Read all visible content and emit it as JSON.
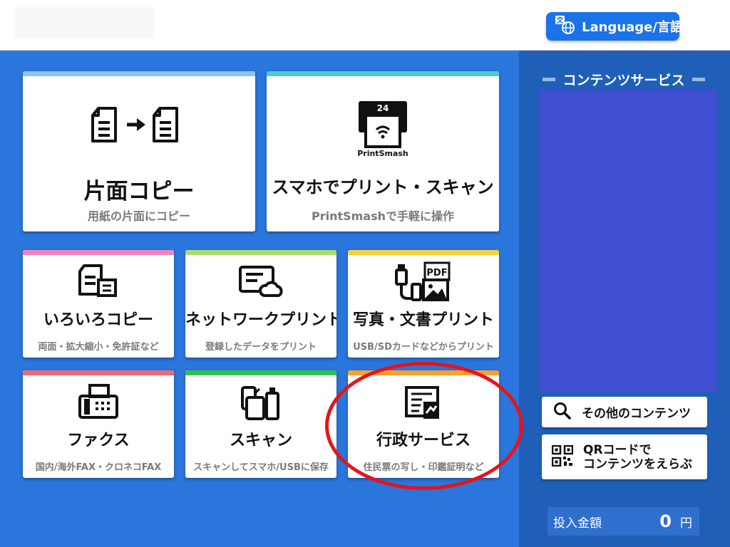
{
  "header": {
    "language_label": "Language/言語",
    "language_icon": "translate-globe-icon"
  },
  "tiles": {
    "single_copy": {
      "title": "片面コピー",
      "subtitle": "用紙の片面にコピー",
      "accent": "#8cc3f5",
      "icon": "document-copy-icon"
    },
    "smartphone_print": {
      "title": "スマホでプリント・スキャン",
      "subtitle": "PrintSmashで手軽に操作",
      "accent": "#4dcfc0",
      "icon": "printsmash-icon",
      "icon_top_label": "24",
      "icon_bottom_label": "PrintSmash"
    },
    "various_copy": {
      "title": "いろいろコピー",
      "subtitle": "両面・拡大縮小・免許証など",
      "accent": "#f084bb",
      "icon": "multi-copy-icon"
    },
    "network_print": {
      "title": "ネットワークプリント",
      "subtitle": "登録したデータをプリント",
      "accent": "#a6e06a",
      "icon": "cloud-document-icon"
    },
    "photo_doc_print": {
      "title": "写真・文書プリント",
      "subtitle": "USB/SDカードなどからプリント",
      "accent": "#f5d23a",
      "icon": "usb-pdf-photo-icon",
      "icon_label": "PDF"
    },
    "fax": {
      "title": "ファクス",
      "subtitle": "国内/海外FAX・クロネコFAX",
      "accent": "#ee6a77",
      "icon": "fax-icon"
    },
    "scan": {
      "title": "スキャン",
      "subtitle": "スキャンしてスマホ/USBに保存",
      "accent": "#32c14a",
      "icon": "scan-device-icon"
    },
    "government": {
      "title": "行政サービス",
      "subtitle": "住民票の写し・印鑑証明など",
      "accent": "#f5a233",
      "icon": "certificate-icon"
    }
  },
  "sidebar": {
    "section_title": "コンテンツサービス",
    "other_content_label": "その他のコンテンツ",
    "other_content_icon": "search-icon",
    "qr_label_line1": "QRコードで",
    "qr_label_line2": "コンテンツをえらぶ",
    "qr_icon": "qr-code-icon",
    "coin_label": "投入金額",
    "coin_value": "0",
    "coin_unit": "円"
  },
  "annotation": {
    "highlight_color": "#e5141c"
  }
}
